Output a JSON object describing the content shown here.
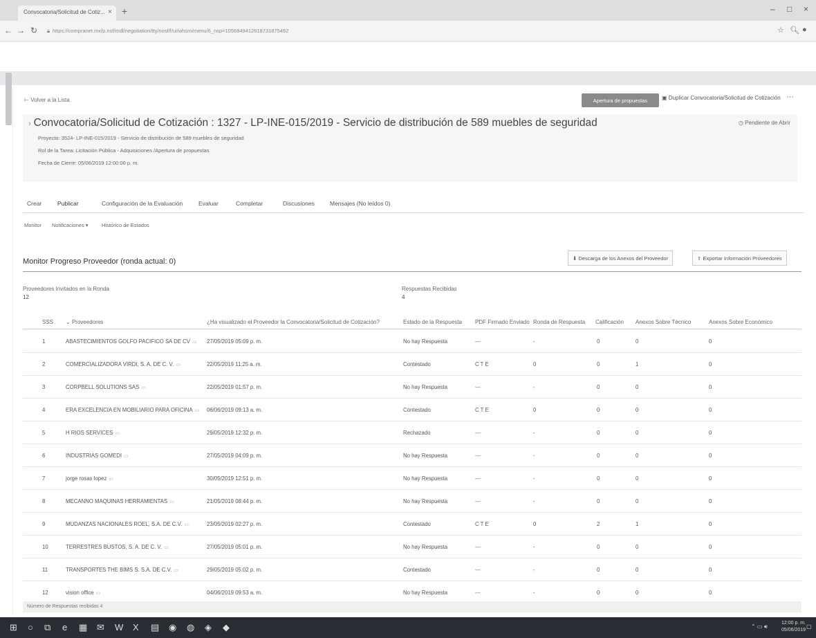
{
  "browser": {
    "tab_title": "Convocatoria/Solicitud de Cotiz...",
    "url": "https://compranet.mx/p.nsf/mdl/negotiation/tty/nosf/f/ui/whsrn/menu/6_nsp=1056849412618731875492",
    "window_controls": {
      "minimize": "–",
      "maximize": "□",
      "close": "×"
    }
  },
  "header": {
    "back_link": "Volver a la Lista",
    "primary_button": "Apertura de propuestas",
    "duplicate_button": "Duplicar Convocatoria/Solicitud de Cotización",
    "more_button": "···",
    "title": "Convocatoria/Solicitud de Cotización : 1327 - LP-INE-015/2019 - Servicio de distribución de 589 muebles de seguridad",
    "status": "Pendiente de Abrir",
    "project": "Proyecto: 3524- LP-INE-015/2019 - Servicio de distribución de 589 muebles de seguridad",
    "task_role": "Rol de la Tarea: Licitación Pública - Adquisiciones /Apertura de propuestas",
    "close_date": "Fecha de Cierre: 05/06/2019 12:00:00 p. m."
  },
  "tabs": [
    "Crear",
    "Publicar",
    "Configuración de la Evaluación",
    "Evaluar",
    "Completar",
    "Discusiones",
    "Mensajes (No leídos 0)"
  ],
  "subtabs": [
    "Monitor",
    "Notificaciones ▾",
    "Histórico de Estados"
  ],
  "monitor": {
    "title": "Monitor Progreso Proveedor (ronda actual: 0)",
    "download_button": "Descarga de los Anexos del Proveedor",
    "export_button": "Exportar Información Proveedores",
    "invited_label": "Proveedores Invitados en la Ronda",
    "invited_value": "12",
    "received_label": "Respuestas Recibidas",
    "received_value": "4"
  },
  "table": {
    "headers": [
      "SSS",
      "Proveedores",
      "¿Ha visualizado el Proveedor la Convocatoria/Solicitud de Cotización?",
      "Estado de la Respuesta",
      "PDF Firmado Enviado",
      "Ronda de Respuesta",
      "Calificación",
      "Anexos Sobre Técnico",
      "Anexos Sobre Económico"
    ],
    "rows": [
      [
        "1",
        "ABASTECIMIENTOS GOLFO PACIFICO SA DE CV",
        "27/05/2019 05:09 p. m.",
        "No hay Respuesta",
        "---",
        "-",
        "0",
        "0",
        "0"
      ],
      [
        "2",
        "COMERCIALIZADORA VIRDI, S. A. DE C. V.",
        "22/05/2019 11:25 a. m.",
        "Contestado",
        "C T E",
        "0",
        "0",
        "1",
        "0"
      ],
      [
        "3",
        "CORPBELL SOLUTIONS SAS",
        "22/05/2019 01:57 p. m.",
        "No hay Respuesta",
        "---",
        "-",
        "0",
        "0",
        "0"
      ],
      [
        "4",
        "ERA EXCELENCIA EN MOBILIARIO PARA OFICINA",
        "06/06/2019 09:13 a. m.",
        "Contestado",
        "C T E",
        "0",
        "0",
        "0",
        "0"
      ],
      [
        "5",
        "H RIOS SERVICES",
        "29/05/2019 12:32 p. m.",
        "Rechazado",
        "---",
        "-",
        "0",
        "0",
        "0"
      ],
      [
        "6",
        "INDUSTRIAS GOMEDI",
        "27/05/2019 04:09 p. m.",
        "No hay Respuesta",
        "---",
        "-",
        "0",
        "0",
        "0"
      ],
      [
        "7",
        "jorge rosas lopez",
        "30/05/2019 12:51 p. m.",
        "No hay Respuesta",
        "---",
        "-",
        "0",
        "0",
        "0"
      ],
      [
        "8",
        "MECANNO MAQUINAS HERRAMIENTAS",
        "21/05/2019 08:44 p. m.",
        "No hay Respuesta",
        "---",
        "-",
        "0",
        "0",
        "0"
      ],
      [
        "9",
        "MUDANZAS NACIONALES ROEL, S.A. DE C.V.",
        "23/05/2019 02:27 p. m.",
        "Contestado",
        "C T E",
        "0",
        "2",
        "1",
        "0"
      ],
      [
        "10",
        "TERRESTRES BUSTOS, S. A. DE C. V.",
        "27/05/2019 05:01 p. m.",
        "No hay Respuesta",
        "---",
        "-",
        "0",
        "0",
        "0"
      ],
      [
        "11",
        "TRANSPORTES THE BIMS S. S.A. DE C.V.",
        "29/05/2019 05:02 p. m.",
        "Contestado",
        "---",
        "-",
        "0",
        "0",
        "0"
      ],
      [
        "12",
        "vision office",
        "04/06/2019 09:53 a. m.",
        "No hay Respuesta",
        "---",
        "-",
        "0",
        "0",
        "0"
      ]
    ],
    "footer": "Número de Respuestas recibidas 4"
  },
  "taskbar": {
    "time": "12:00 p. m.",
    "date": "05/06/2019"
  },
  "icons": {
    "back": "arrow-left-icon",
    "duplicate": "copy-icon",
    "download": "download-icon",
    "export": "export-icon",
    "status": "clock-icon",
    "document": "document-icon"
  }
}
